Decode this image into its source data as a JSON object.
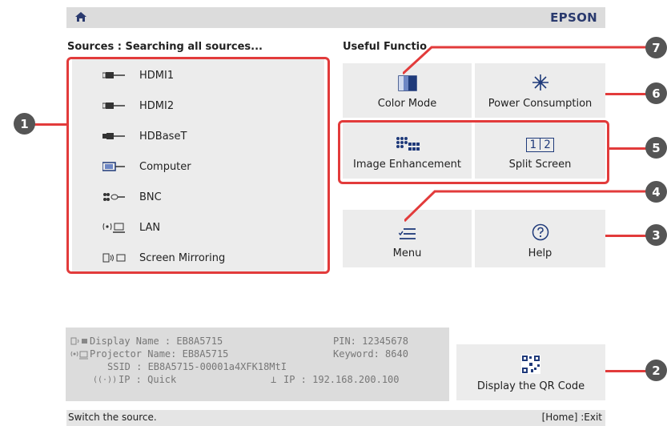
{
  "header": {
    "brand": "EPSON"
  },
  "sources": {
    "title": "Sources : Searching all sources...",
    "items": [
      {
        "label": "HDMI1",
        "icon": "hdmi-icon"
      },
      {
        "label": "HDMI2",
        "icon": "hdmi-icon"
      },
      {
        "label": "HDBaseT",
        "icon": "hdbaset-icon"
      },
      {
        "label": "Computer",
        "icon": "vga-icon"
      },
      {
        "label": "BNC",
        "icon": "bnc-icon"
      },
      {
        "label": "LAN",
        "icon": "lan-icon"
      },
      {
        "label": "Screen Mirroring",
        "icon": "screen-mirroring-icon"
      }
    ]
  },
  "useful": {
    "title": "Useful Functio",
    "color_mode": "Color Mode",
    "power_consumption": "Power Consumption",
    "image_enhancement": "Image Enhancement",
    "split_screen": "Split Screen",
    "split_icon_1": "1",
    "split_icon_2": "2",
    "menu": "Menu",
    "help": "Help"
  },
  "info": {
    "display_name": "Display Name :  EB8A5715",
    "projector_name": "Projector Name:  EB8A5715",
    "ssid": "SSID :  EB8A5715-00001a4XFK18MtI",
    "ip_quick": "IP :  Quick",
    "ip_addr": "IP :  192.168.200.100",
    "pin": "PIN:  12345678",
    "keyword": "Keyword:  8640"
  },
  "qr_button": "Display the QR Code",
  "footer": {
    "hint": "Switch the source.",
    "exit": "[Home] :Exit"
  },
  "callouts": [
    "1",
    "2",
    "3",
    "4",
    "5",
    "6",
    "7"
  ],
  "colors": {
    "accent": "#e23b3b",
    "callout": "#555555"
  }
}
